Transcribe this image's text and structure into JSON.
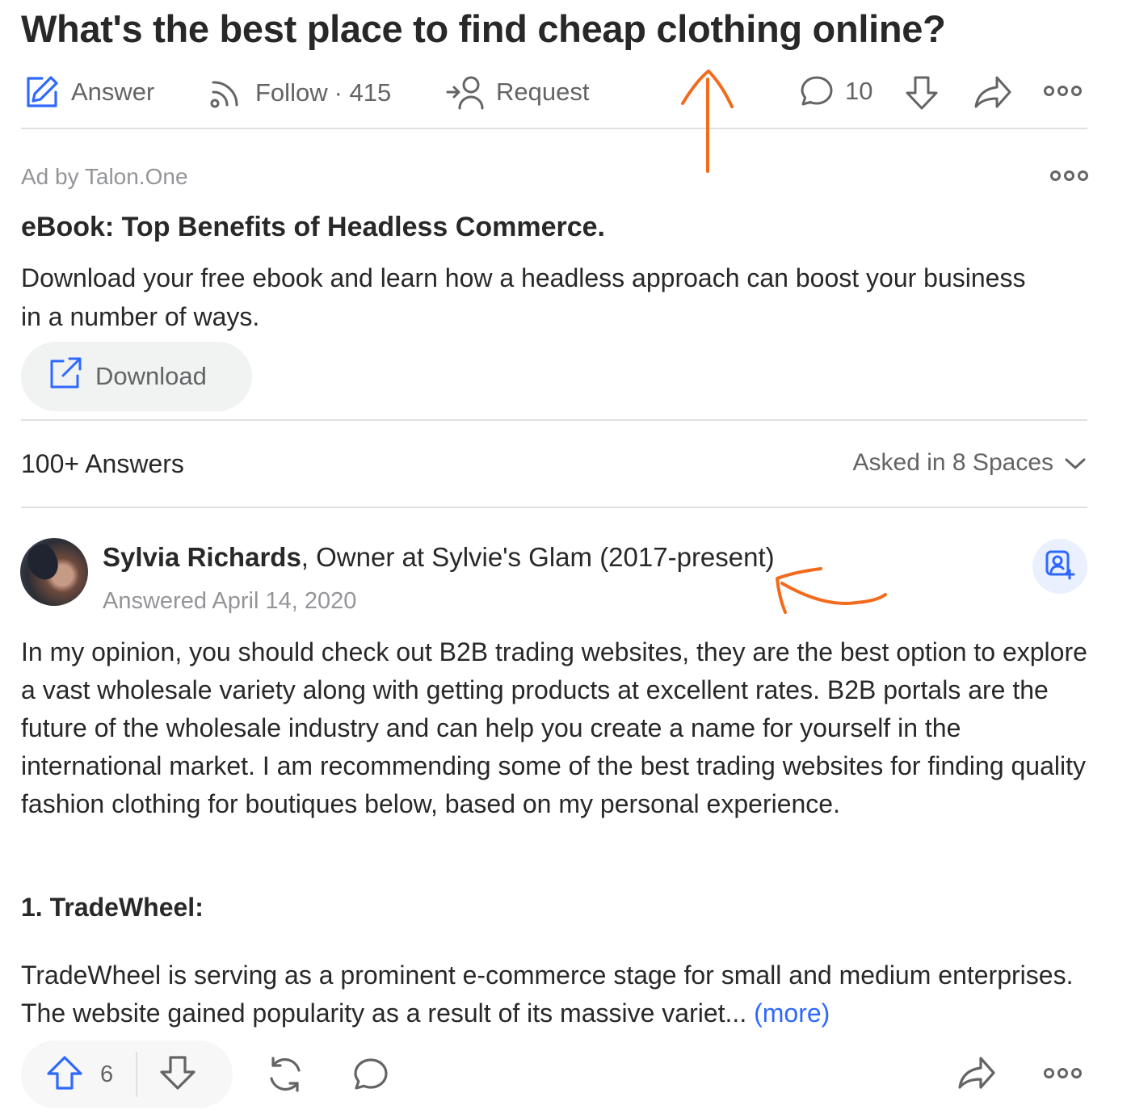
{
  "question": {
    "title": "What's the best place to find cheap clothing online?"
  },
  "actions": {
    "answer_label": "Answer",
    "follow_label": "Follow",
    "follow_count": "· 415",
    "request_label": "Request",
    "comment_count": "10"
  },
  "ad": {
    "by": "Ad by Talon.One",
    "title": "eBook: Top Benefits of Headless Commerce.",
    "body": "Download your free ebook and learn how a headless approach can boost your business in a number of ways.",
    "button_label": "Download"
  },
  "answers_header": {
    "count_label": "100+ Answers",
    "asked_in": "Asked in 8 Spaces"
  },
  "answer": {
    "author_name": "Sylvia Richards",
    "author_credential": ", Owner at Sylvie's Glam (2017-present)",
    "date": "Answered April 14, 2020",
    "text": "In my opinion, you should check out B2B trading websites, they are the best option to explore a vast wholesale variety along with getting products at excellent rates. B2B portals are the future of the wholesale industry and can help you create a name for yourself in the international market. I am recommending some of the best trading websites for finding quality fashion clothing for boutiques below, based on my personal experience.",
    "section_heading": "1. TradeWheel:",
    "section_text": "TradeWheel is serving as a prominent e-commerce stage for small and medium enterprises. The website gained popularity as a result of its massive variet... ",
    "more_label": "(more)",
    "upvote_count": "6"
  },
  "colors": {
    "brand_blue": "#2e69ff",
    "annotation_orange": "#f26a1b",
    "text_primary": "#282829",
    "text_secondary": "#636466",
    "text_muted": "#939598"
  },
  "icons": {
    "answer": "pencil-square-icon",
    "follow": "rss-icon",
    "request": "person-arrow-icon",
    "comment": "speech-bubble-icon",
    "downvote": "arrow-down-icon",
    "share": "share-arrow-icon",
    "more": "three-dots-icon",
    "download": "external-link-icon",
    "chevron": "chevron-down-icon",
    "upvote": "arrow-up-icon",
    "reshare": "refresh-icon",
    "follow_author": "add-person-icon"
  }
}
